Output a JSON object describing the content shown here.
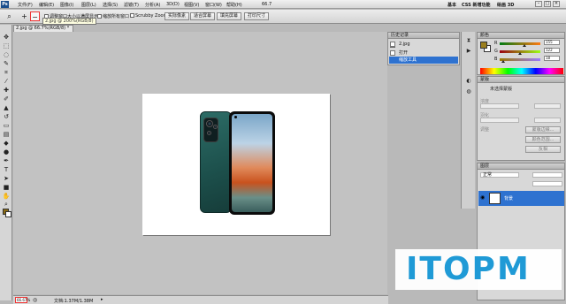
{
  "menubar": {
    "logo": "Ps",
    "items": [
      "文件(F)",
      "编辑(E)",
      "图像(I)",
      "图层(L)",
      "选择(S)",
      "滤镜(T)",
      "分析(A)",
      "3D(D)",
      "视图(V)",
      "窗口(W)",
      "帮助(H)"
    ],
    "zoom": "66.7",
    "right": [
      "基本",
      "CSS 新增功能",
      "绘画 3D"
    ]
  },
  "options": {
    "resize_windows": "调整窗口大小以满屏显示",
    "zoom_all": "缩放所有窗口",
    "scrubby": "Scrubby Zoom",
    "btn_actual": "实际像素",
    "btn_fit": "适合屏幕",
    "btn_fill": "填充屏幕",
    "btn_print": "打印尺寸"
  },
  "tooltip": "2.jpg @ 200%(RGB/8)",
  "document": {
    "tab_title": "2.jpg @ 66.7%(RGB/8) *"
  },
  "history": {
    "title": "历史记录",
    "snapshot": "2.jpg",
    "items": [
      "打开",
      "缩放工具"
    ]
  },
  "color": {
    "title": "颜色",
    "r": "155",
    "g": "122",
    "b": "18",
    "fg": "#9b7f1e"
  },
  "masks": {
    "title": "蒙版",
    "subtitle": "未选择蒙版",
    "density": "浓度",
    "feather": "羽化",
    "refine": "调整",
    "btn_edge": "蒙版边缘...",
    "btn_color": "颜色范围...",
    "btn_invert": "反相"
  },
  "layers": {
    "title": "图层",
    "blend": "正常",
    "layer_name": "背景"
  },
  "status": {
    "zoom": "66.67%",
    "doc": "文档:1.37M/1.38M"
  },
  "watermark": "ITOPM"
}
